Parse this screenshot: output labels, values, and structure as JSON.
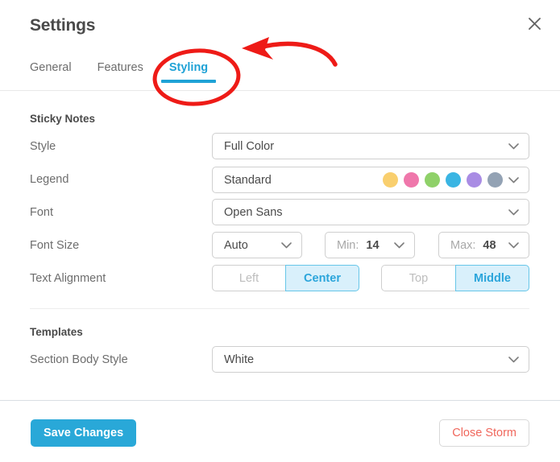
{
  "header": {
    "title": "Settings",
    "close_icon": "close-icon"
  },
  "tabs": [
    {
      "label": "General",
      "active": false
    },
    {
      "label": "Features",
      "active": false
    },
    {
      "label": "Styling",
      "active": true
    }
  ],
  "sections": [
    {
      "heading": "Sticky Notes",
      "rows": [
        {
          "label": "Style",
          "value": "Full Color"
        },
        {
          "label": "Legend",
          "value": "Standard"
        },
        {
          "label": "Font",
          "value": "Open Sans"
        },
        {
          "label": "Font Size",
          "value": "Auto"
        },
        {
          "label": "Text Alignment",
          "value": ""
        }
      ]
    },
    {
      "heading": "Templates",
      "rows": [
        {
          "label": "Section Body Style",
          "value": "White"
        }
      ]
    }
  ],
  "legend_swatches": [
    {
      "name": "yellow",
      "color": "#f9cf6e"
    },
    {
      "name": "pink",
      "color": "#ef77ab"
    },
    {
      "name": "green",
      "color": "#8fd169"
    },
    {
      "name": "blue",
      "color": "#3ab5e3"
    },
    {
      "name": "purple",
      "color": "#a98ce4"
    },
    {
      "name": "gray",
      "color": "#93a2b4"
    }
  ],
  "font_size": {
    "mode": "Auto",
    "min_prefix": "Min:",
    "min_value": "14",
    "max_prefix": "Max:",
    "max_value": "48"
  },
  "text_alignment": {
    "horizontal": [
      {
        "label": "Left",
        "selected": false
      },
      {
        "label": "Center",
        "selected": true
      }
    ],
    "vertical": [
      {
        "label": "Top",
        "selected": false
      },
      {
        "label": "Middle",
        "selected": true
      }
    ]
  },
  "footer": {
    "save_label": "Save Changes",
    "close_label": "Close Storm"
  },
  "annotation": {
    "color": "#ee1b17",
    "shapes": "ellipse-around-styling-tab-and-curved-arrow"
  },
  "theme": {
    "accent": "#1fa2d6",
    "accent_fill": "#d9f0fb",
    "primary_button": "#29a8d8",
    "danger_text": "#f0675c",
    "text": "#4a4a4a",
    "muted_text": "#6d6d6d",
    "border": "#cfcfcf"
  }
}
